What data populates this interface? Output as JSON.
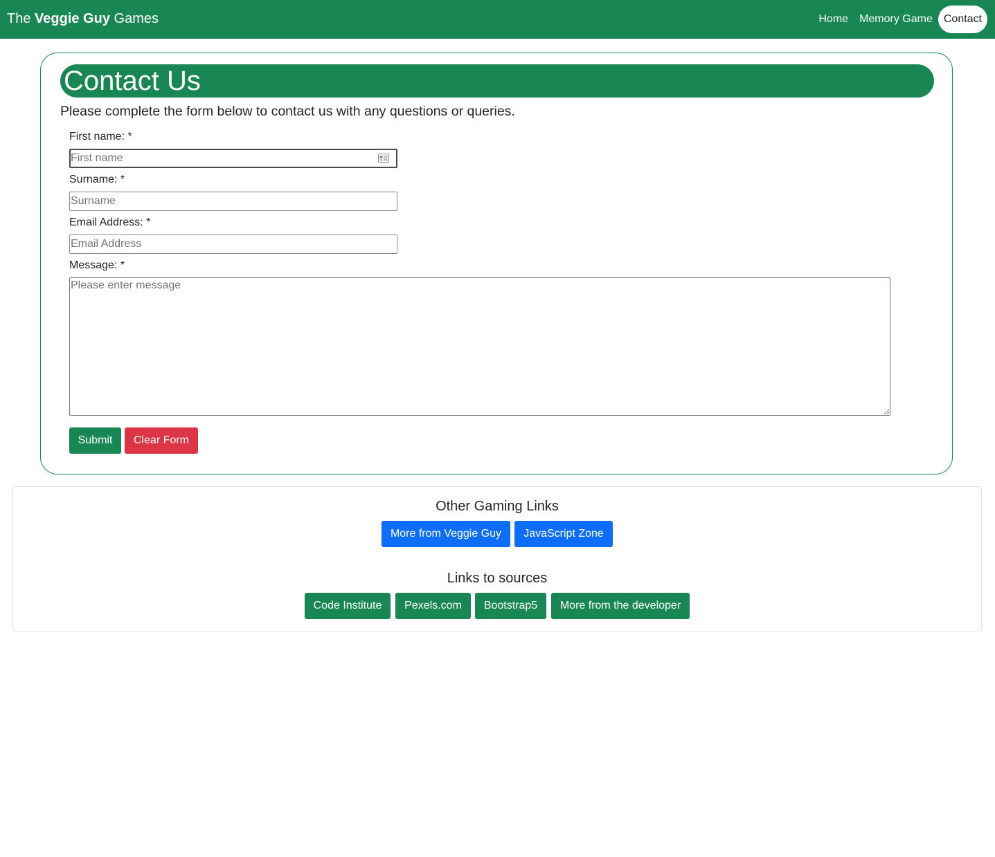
{
  "navbar": {
    "brand": {
      "prefix": "The ",
      "bold": "Veggie Guy",
      "suffix": " Games"
    },
    "links": [
      {
        "label": "Home",
        "active": false
      },
      {
        "label": "Memory Game",
        "active": false
      },
      {
        "label": "Contact",
        "active": true
      }
    ]
  },
  "contact": {
    "title": "Contact Us",
    "intro": "Please complete the form below to contact us with any questions or queries.",
    "first_name": {
      "label": "First name: *",
      "placeholder": "First name"
    },
    "surname": {
      "label": "Surname: *",
      "placeholder": "Surname"
    },
    "email": {
      "label": "Email Address: *",
      "placeholder": "Email Address"
    },
    "message": {
      "label": "Message: *",
      "placeholder": "Please enter message"
    },
    "submit_label": "Submit",
    "clear_label": "Clear Form"
  },
  "footer": {
    "gaming_heading": "Other Gaming Links",
    "gaming_links": [
      "More from Veggie Guy",
      "JavaScript Zone"
    ],
    "sources_heading": "Links to sources",
    "source_links": [
      "Code Institute",
      "Pexels.com",
      "Bootstrap5",
      "More from the developer"
    ]
  },
  "colors": {
    "brand_green": "#198754",
    "danger_red": "#dc3545",
    "primary_blue": "#0d6efd"
  },
  "icons": {
    "autofill": "contact-card-icon"
  }
}
